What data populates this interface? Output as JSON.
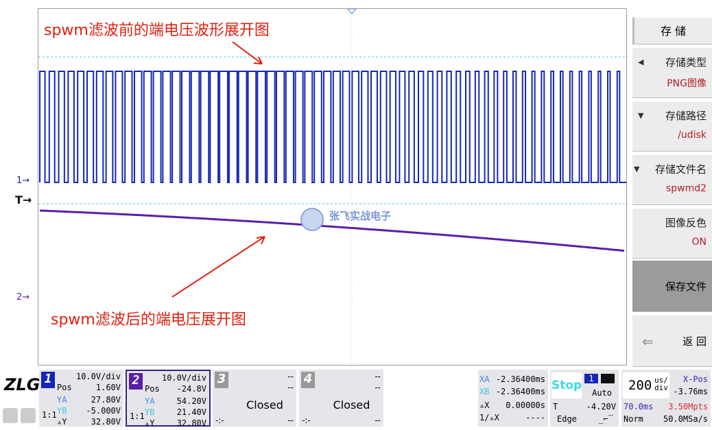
{
  "annotations": {
    "top": "spwm滤波前的端电压波形展开图",
    "bottom": "spwm滤波后的端电压展开图"
  },
  "watermark": "张飞实战电子",
  "markers": {
    "ch1": "1",
    "trigger": "T",
    "ch2": "2"
  },
  "colors": {
    "ch1": "#1428b4",
    "ch2": "#5a1eaa",
    "accent_cyan": "#3cc8dc",
    "annotation": "#e02010"
  },
  "side_menu": {
    "title": "存 储",
    "items": [
      {
        "label": "存储类型",
        "value": "PNG图像",
        "icon": "triangle-left-icon"
      },
      {
        "label": "存储路径",
        "value": "/udisk",
        "icon": "triangle-down-icon"
      },
      {
        "label": "存储文件名",
        "value": "spwmd2",
        "icon": "triangle-down-icon"
      },
      {
        "label": "图像反色",
        "value": "ON"
      }
    ],
    "save_file": "保存文件",
    "back": "返 回"
  },
  "logo": "ZLG",
  "channels": [
    {
      "num": "1",
      "scale": "10.0V/div",
      "pos_label": "Pos",
      "pos": "1.60V",
      "ya": "27.80V",
      "yb": "-5.000V",
      "dy": "32.80V",
      "ratio": "1:1"
    },
    {
      "num": "2",
      "scale": "10.0V/div",
      "pos_label": "Pos",
      "pos": "-24.8V",
      "ya": "54.20V",
      "yb": "21.40V",
      "dy": "32.80V",
      "ratio": "1:1"
    },
    {
      "num": "3",
      "status": "Closed",
      "dash": "--",
      "ratio": "-:-"
    },
    {
      "num": "4",
      "status": "Closed",
      "dash": "--",
      "ratio": "-:-"
    }
  ],
  "labels": {
    "ya": "YA",
    "yb": "YB",
    "dy": "▵Y"
  },
  "cursor": {
    "xa_label": "XA",
    "xa": "-2.36400ms",
    "xb_label": "XB",
    "xb": "-2.36400ms",
    "dx_label": "▵X",
    "dx": "0.00000s",
    "inv_label": "1/▵X",
    "inv": "----"
  },
  "trigger": {
    "state": "Stop",
    "source": "1",
    "mode": "Auto",
    "t_label": "T",
    "level": "-4.20V",
    "type": "Edge"
  },
  "timebase": {
    "value": "200",
    "unit_top": "us/",
    "unit_bottom": "div",
    "xpos_label": "X-Pos",
    "xpos": "-3.76ms",
    "length": "70.0ms",
    "points": "3.50Mpts",
    "acq": "Norm",
    "rate": "50.0MSa/s"
  }
}
